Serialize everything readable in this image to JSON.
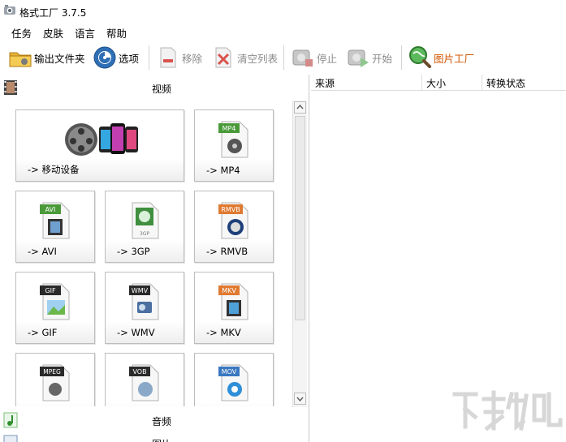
{
  "window": {
    "title": "格式工厂 3.7.5"
  },
  "menu": [
    "任务",
    "皮肤",
    "语言",
    "帮助"
  ],
  "toolbar": {
    "output_folder": "输出文件夹",
    "options": "选项",
    "remove": "移除",
    "clear_list": "清空列表",
    "stop": "停止",
    "start": "开始",
    "picture_factory": "图片工厂"
  },
  "categories": {
    "video": "视频",
    "audio": "音频",
    "picture": "图片"
  },
  "tiles": {
    "mobile": "-> 移动设备",
    "mp4": {
      "badge": "MP4",
      "label": "-> MP4"
    },
    "avi": {
      "badge": "AVI",
      "label": "-> AVI"
    },
    "3gp": {
      "badge": "3GP",
      "label": "-> 3GP"
    },
    "rmvb": {
      "badge": "RMVB",
      "label": "-> RMVB"
    },
    "gif": {
      "badge": "GIF",
      "label": "-> GIF"
    },
    "wmv": {
      "badge": "WMV",
      "label": "-> WMV"
    },
    "mkv": {
      "badge": "MKV",
      "label": "-> MKV"
    },
    "mpeg": {
      "badge": "MPEG"
    },
    "vob": {
      "badge": "VOB"
    },
    "mov": {
      "badge": "MOV"
    }
  },
  "task_list": {
    "columns": [
      "来源",
      "大小",
      "转换状态"
    ]
  },
  "colors": {
    "accent_orange": "#d35400",
    "badge_green": "#4a9a3a",
    "badge_dark": "#2a2a2a",
    "badge_orange": "#e07a30",
    "badge_blue": "#3a78c0"
  }
}
